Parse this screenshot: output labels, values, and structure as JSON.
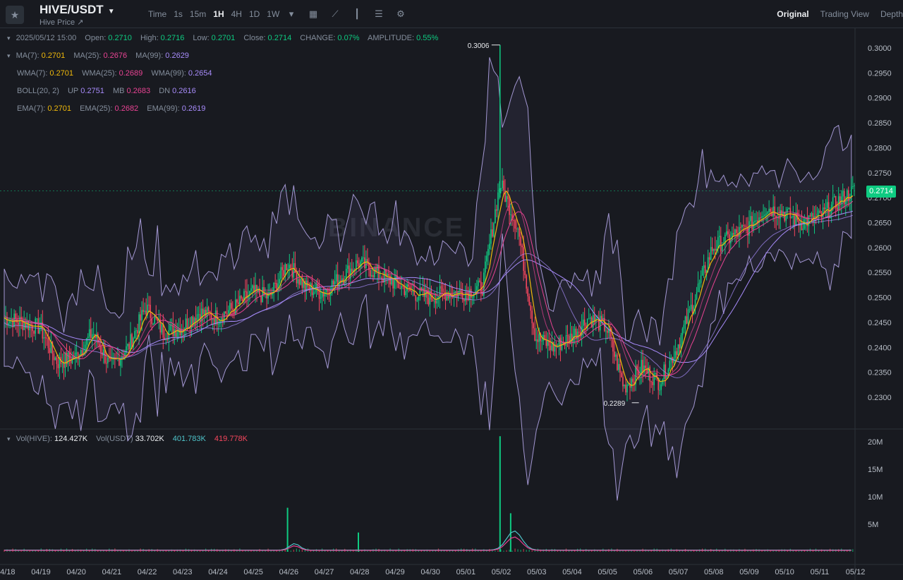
{
  "header": {
    "star_icon": "star-icon",
    "pair": "HIVE/USDT",
    "subtitle": "Hive Price ↗",
    "intervals": [
      "Time",
      "1s",
      "15m",
      "1H",
      "4H",
      "1D",
      "1W"
    ],
    "active_interval": "1H",
    "tools": [
      "chevron-down-icon",
      "calendar-icon",
      "indicator-icon",
      "candle-type-icon",
      "layout-icon",
      "gear-icon"
    ],
    "views": [
      "Original",
      "Trading View",
      "Depth"
    ]
  },
  "ohlc": {
    "date": "2025/05/12 15:00",
    "open_label": "Open:",
    "open": "0.2710",
    "high_label": "High:",
    "high": "0.2716",
    "low_label": "Low:",
    "low": "0.2701",
    "close_label": "Close:",
    "close": "0.2714",
    "change_label": "CHANGE:",
    "change": "0.07%",
    "amp_label": "AMPLITUDE:",
    "amplitude": "0.55%"
  },
  "indicators": {
    "ma": [
      {
        "k": "MA(7):",
        "v": "0.2701"
      },
      {
        "k": "MA(25):",
        "v": "0.2676"
      },
      {
        "k": "MA(99):",
        "v": "0.2629"
      }
    ],
    "wma": [
      {
        "k": "WMA(7):",
        "v": "0.2701"
      },
      {
        "k": "WMA(25):",
        "v": "0.2689"
      },
      {
        "k": "WMA(99):",
        "v": "0.2654"
      }
    ],
    "boll": {
      "k": "BOLL(20, 2)",
      "up_k": "UP",
      "up": "0.2751",
      "mb_k": "MB",
      "mb": "0.2683",
      "dn_k": "DN",
      "dn": "0.2616"
    },
    "ema": [
      {
        "k": "EMA(7):",
        "v": "0.2701"
      },
      {
        "k": "EMA(25):",
        "v": "0.2682"
      },
      {
        "k": "EMA(99):",
        "v": "0.2619"
      }
    ]
  },
  "volume": {
    "k1": "Vol(HIVE):",
    "v1": "124.427K",
    "k2": "Vol(USDT)",
    "v2": "33.702K",
    "v3": "401.783K",
    "v4": "419.778K"
  },
  "last_price": "0.2714",
  "watermark": "BINANCE",
  "colors": {
    "up": "#0ecb81",
    "down": "#f6465d",
    "ma7": "#f0b90b",
    "ma25": "#e84393",
    "ma99": "#a78bfa",
    "boll": "#c4b5fd"
  },
  "chart_data": {
    "type": "candlestick",
    "price_ticks": [
      "0.3000",
      "0.2950",
      "0.2900",
      "0.2850",
      "0.2800",
      "0.2750",
      "0.2700",
      "0.2650",
      "0.2600",
      "0.2550",
      "0.2500",
      "0.2450",
      "0.2400",
      "0.2350",
      "0.2300"
    ],
    "price_range": [
      0.2283,
      0.308
    ],
    "volume_ticks": [
      "20M",
      "15M",
      "10M",
      "5M"
    ],
    "volume_range": [
      0,
      21000000
    ],
    "x_labels": [
      "04/18",
      "04/19",
      "04/20",
      "04/21",
      "04/22",
      "04/23",
      "04/24",
      "04/25",
      "04/26",
      "04/27",
      "04/28",
      "04/29",
      "04/30",
      "05/01",
      "05/02",
      "05/03",
      "05/04",
      "05/05",
      "05/06",
      "05/07",
      "05/08",
      "05/09",
      "05/10",
      "05/11",
      "05/12"
    ],
    "high_marker": "0.3006",
    "low_marker": "0.2289",
    "close_path": [
      {
        "d": "04/18",
        "c": 0.246
      },
      {
        "d": "04/18.5",
        "c": 0.245
      },
      {
        "d": "04/19",
        "c": 0.244
      },
      {
        "d": "04/19.5",
        "c": 0.237
      },
      {
        "d": "04/20",
        "c": 0.238
      },
      {
        "d": "04/20.5",
        "c": 0.243
      },
      {
        "d": "04/21",
        "c": 0.236
      },
      {
        "d": "04/21.5",
        "c": 0.24
      },
      {
        "d": "04/22",
        "c": 0.248
      },
      {
        "d": "04/22.5",
        "c": 0.243
      },
      {
        "d": "04/23",
        "c": 0.244
      },
      {
        "d": "04/23.5",
        "c": 0.247
      },
      {
        "d": "04/24",
        "c": 0.246
      },
      {
        "d": "04/24.5",
        "c": 0.248
      },
      {
        "d": "04/25",
        "c": 0.251
      },
      {
        "d": "04/25.5",
        "c": 0.25
      },
      {
        "d": "04/26",
        "c": 0.257
      },
      {
        "d": "04/26.5",
        "c": 0.252
      },
      {
        "d": "04/27",
        "c": 0.251
      },
      {
        "d": "04/27.5",
        "c": 0.254
      },
      {
        "d": "04/28",
        "c": 0.257
      },
      {
        "d": "04/28.5",
        "c": 0.255
      },
      {
        "d": "04/29",
        "c": 0.253
      },
      {
        "d": "04/29.5",
        "c": 0.251
      },
      {
        "d": "04/30",
        "c": 0.25
      },
      {
        "d": "04/30.5",
        "c": 0.251
      },
      {
        "d": "05/01",
        "c": 0.251
      },
      {
        "d": "05/01.5",
        "c": 0.252
      },
      {
        "d": "05/02",
        "c": 0.273
      },
      {
        "d": "05/02.5",
        "c": 0.264
      },
      {
        "d": "05/03",
        "c": 0.242
      },
      {
        "d": "05/03.5",
        "c": 0.24
      },
      {
        "d": "05/04",
        "c": 0.242
      },
      {
        "d": "05/04.5",
        "c": 0.246
      },
      {
        "d": "05/05",
        "c": 0.244
      },
      {
        "d": "05/05.5",
        "c": 0.232
      },
      {
        "d": "05/06",
        "c": 0.236
      },
      {
        "d": "05/06.5",
        "c": 0.233
      },
      {
        "d": "05/07",
        "c": 0.24
      },
      {
        "d": "05/07.5",
        "c": 0.25
      },
      {
        "d": "05/08",
        "c": 0.26
      },
      {
        "d": "05/08.5",
        "c": 0.262
      },
      {
        "d": "05/09",
        "c": 0.264
      },
      {
        "d": "05/09.5",
        "c": 0.268
      },
      {
        "d": "05/10",
        "c": 0.267
      },
      {
        "d": "05/10.5",
        "c": 0.265
      },
      {
        "d": "05/11",
        "c": 0.266
      },
      {
        "d": "05/11.5",
        "c": 0.269
      },
      {
        "d": "05/12",
        "c": 0.2714
      }
    ],
    "volume_spikes": [
      {
        "d": "04/26",
        "v": 8000000
      },
      {
        "d": "04/28",
        "v": 3500000
      },
      {
        "d": "05/02",
        "v": 21000000
      },
      {
        "d": "05/02.3",
        "v": 7000000
      }
    ]
  }
}
